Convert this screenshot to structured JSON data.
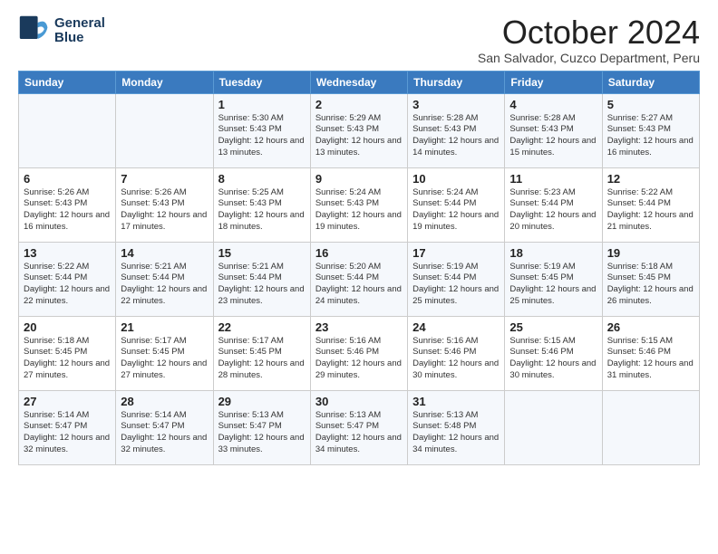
{
  "logo": {
    "line1": "General",
    "line2": "Blue"
  },
  "title": "October 2024",
  "subtitle": "San Salvador, Cuzco Department, Peru",
  "days_of_week": [
    "Sunday",
    "Monday",
    "Tuesday",
    "Wednesday",
    "Thursday",
    "Friday",
    "Saturday"
  ],
  "weeks": [
    [
      {
        "day": "",
        "info": ""
      },
      {
        "day": "",
        "info": ""
      },
      {
        "day": "1",
        "info": "Sunrise: 5:30 AM\nSunset: 5:43 PM\nDaylight: 12 hours and 13 minutes."
      },
      {
        "day": "2",
        "info": "Sunrise: 5:29 AM\nSunset: 5:43 PM\nDaylight: 12 hours and 13 minutes."
      },
      {
        "day": "3",
        "info": "Sunrise: 5:28 AM\nSunset: 5:43 PM\nDaylight: 12 hours and 14 minutes."
      },
      {
        "day": "4",
        "info": "Sunrise: 5:28 AM\nSunset: 5:43 PM\nDaylight: 12 hours and 15 minutes."
      },
      {
        "day": "5",
        "info": "Sunrise: 5:27 AM\nSunset: 5:43 PM\nDaylight: 12 hours and 16 minutes."
      }
    ],
    [
      {
        "day": "6",
        "info": "Sunrise: 5:26 AM\nSunset: 5:43 PM\nDaylight: 12 hours and 16 minutes."
      },
      {
        "day": "7",
        "info": "Sunrise: 5:26 AM\nSunset: 5:43 PM\nDaylight: 12 hours and 17 minutes."
      },
      {
        "day": "8",
        "info": "Sunrise: 5:25 AM\nSunset: 5:43 PM\nDaylight: 12 hours and 18 minutes."
      },
      {
        "day": "9",
        "info": "Sunrise: 5:24 AM\nSunset: 5:43 PM\nDaylight: 12 hours and 19 minutes."
      },
      {
        "day": "10",
        "info": "Sunrise: 5:24 AM\nSunset: 5:44 PM\nDaylight: 12 hours and 19 minutes."
      },
      {
        "day": "11",
        "info": "Sunrise: 5:23 AM\nSunset: 5:44 PM\nDaylight: 12 hours and 20 minutes."
      },
      {
        "day": "12",
        "info": "Sunrise: 5:22 AM\nSunset: 5:44 PM\nDaylight: 12 hours and 21 minutes."
      }
    ],
    [
      {
        "day": "13",
        "info": "Sunrise: 5:22 AM\nSunset: 5:44 PM\nDaylight: 12 hours and 22 minutes."
      },
      {
        "day": "14",
        "info": "Sunrise: 5:21 AM\nSunset: 5:44 PM\nDaylight: 12 hours and 22 minutes."
      },
      {
        "day": "15",
        "info": "Sunrise: 5:21 AM\nSunset: 5:44 PM\nDaylight: 12 hours and 23 minutes."
      },
      {
        "day": "16",
        "info": "Sunrise: 5:20 AM\nSunset: 5:44 PM\nDaylight: 12 hours and 24 minutes."
      },
      {
        "day": "17",
        "info": "Sunrise: 5:19 AM\nSunset: 5:44 PM\nDaylight: 12 hours and 25 minutes."
      },
      {
        "day": "18",
        "info": "Sunrise: 5:19 AM\nSunset: 5:45 PM\nDaylight: 12 hours and 25 minutes."
      },
      {
        "day": "19",
        "info": "Sunrise: 5:18 AM\nSunset: 5:45 PM\nDaylight: 12 hours and 26 minutes."
      }
    ],
    [
      {
        "day": "20",
        "info": "Sunrise: 5:18 AM\nSunset: 5:45 PM\nDaylight: 12 hours and 27 minutes."
      },
      {
        "day": "21",
        "info": "Sunrise: 5:17 AM\nSunset: 5:45 PM\nDaylight: 12 hours and 27 minutes."
      },
      {
        "day": "22",
        "info": "Sunrise: 5:17 AM\nSunset: 5:45 PM\nDaylight: 12 hours and 28 minutes."
      },
      {
        "day": "23",
        "info": "Sunrise: 5:16 AM\nSunset: 5:46 PM\nDaylight: 12 hours and 29 minutes."
      },
      {
        "day": "24",
        "info": "Sunrise: 5:16 AM\nSunset: 5:46 PM\nDaylight: 12 hours and 30 minutes."
      },
      {
        "day": "25",
        "info": "Sunrise: 5:15 AM\nSunset: 5:46 PM\nDaylight: 12 hours and 30 minutes."
      },
      {
        "day": "26",
        "info": "Sunrise: 5:15 AM\nSunset: 5:46 PM\nDaylight: 12 hours and 31 minutes."
      }
    ],
    [
      {
        "day": "27",
        "info": "Sunrise: 5:14 AM\nSunset: 5:47 PM\nDaylight: 12 hours and 32 minutes."
      },
      {
        "day": "28",
        "info": "Sunrise: 5:14 AM\nSunset: 5:47 PM\nDaylight: 12 hours and 32 minutes."
      },
      {
        "day": "29",
        "info": "Sunrise: 5:13 AM\nSunset: 5:47 PM\nDaylight: 12 hours and 33 minutes."
      },
      {
        "day": "30",
        "info": "Sunrise: 5:13 AM\nSunset: 5:47 PM\nDaylight: 12 hours and 34 minutes."
      },
      {
        "day": "31",
        "info": "Sunrise: 5:13 AM\nSunset: 5:48 PM\nDaylight: 12 hours and 34 minutes."
      },
      {
        "day": "",
        "info": ""
      },
      {
        "day": "",
        "info": ""
      }
    ]
  ]
}
